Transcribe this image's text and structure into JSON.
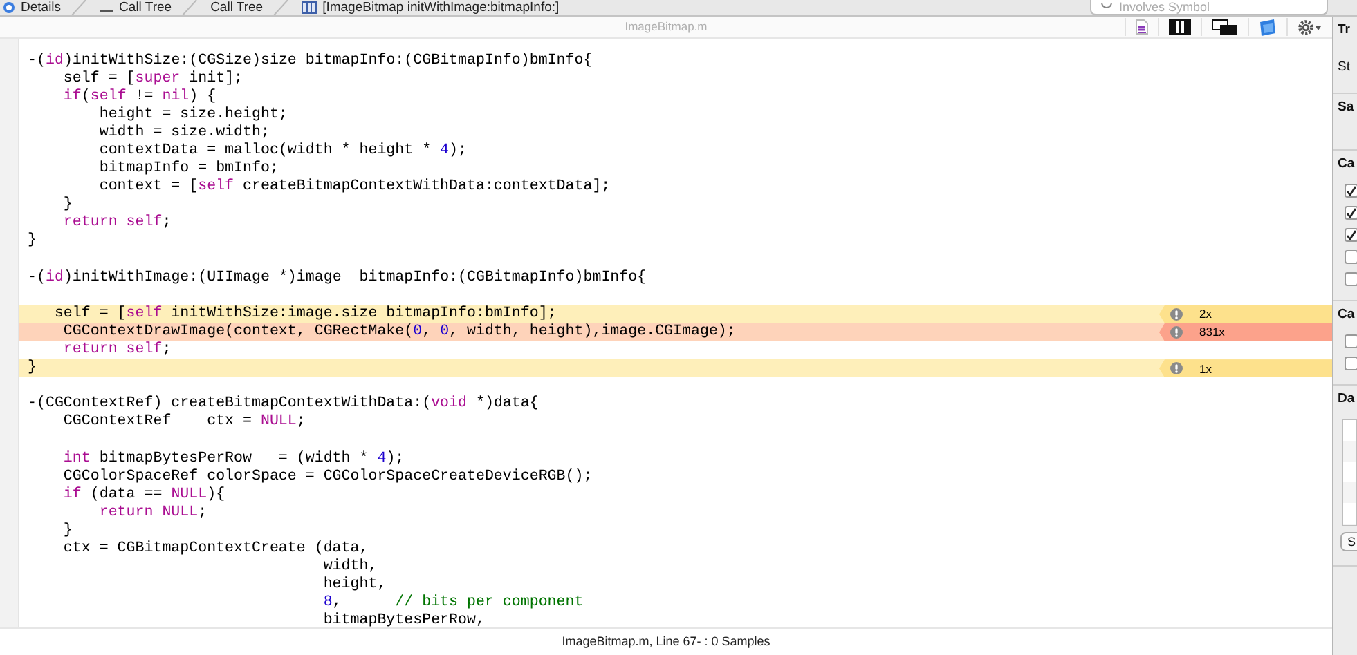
{
  "breadcrumbs": {
    "items": [
      {
        "kind": "circle",
        "label": "Details"
      },
      {
        "kind": "list",
        "label": "Call Tree"
      },
      {
        "kind": "none",
        "label": "Call Tree"
      },
      {
        "kind": "grid",
        "label": "[ImageBitmap initWithImage:bitmapInfo:]"
      }
    ],
    "search": {
      "placeholder": "Involves Symbol"
    }
  },
  "editor": {
    "title": "ImageBitmap.m",
    "lines": [
      {
        "kind": "code",
        "segments": [
          {
            "kind": "plain",
            "text": "-("
          },
          {
            "kind": "keyword",
            "text": "id"
          },
          {
            "kind": "plain",
            "text": ")initWithSize:(CGSize)size bitmapInfo:(CGBitmapInfo)bmInfo{"
          }
        ]
      },
      {
        "kind": "code",
        "segments": [
          {
            "kind": "plain",
            "text": "    self = ["
          },
          {
            "kind": "keyword",
            "text": "super"
          },
          {
            "kind": "plain",
            "text": " init];"
          }
        ]
      },
      {
        "kind": "code",
        "segments": [
          {
            "kind": "keyword",
            "text": "    if"
          },
          {
            "kind": "plain",
            "text": "("
          },
          {
            "kind": "keyword",
            "text": "self"
          },
          {
            "kind": "plain",
            "text": " != "
          },
          {
            "kind": "keyword",
            "text": "nil"
          },
          {
            "kind": "plain",
            "text": ") {"
          }
        ]
      },
      {
        "kind": "code",
        "segments": [
          {
            "kind": "plain",
            "text": "        height = size.height;"
          }
        ]
      },
      {
        "kind": "code",
        "segments": [
          {
            "kind": "plain",
            "text": "        width = size.width;"
          }
        ]
      },
      {
        "kind": "code",
        "segments": [
          {
            "kind": "plain",
            "text": "        contextData = malloc(width * height * "
          },
          {
            "kind": "number",
            "text": "4"
          },
          {
            "kind": "plain",
            "text": ");"
          }
        ]
      },
      {
        "kind": "code",
        "segments": [
          {
            "kind": "plain",
            "text": "        bitmapInfo = bmInfo;"
          }
        ]
      },
      {
        "kind": "code",
        "segments": [
          {
            "kind": "plain",
            "text": "        context = ["
          },
          {
            "kind": "keyword",
            "text": "self"
          },
          {
            "kind": "plain",
            "text": " createBitmapContextWithData:contextData];"
          }
        ]
      },
      {
        "kind": "code",
        "segments": [
          {
            "kind": "plain",
            "text": "    }"
          }
        ]
      },
      {
        "kind": "code",
        "segments": [
          {
            "kind": "keyword",
            "text": "    return self"
          },
          {
            "kind": "plain",
            "text": ";"
          }
        ]
      },
      {
        "kind": "code",
        "segments": [
          {
            "kind": "plain",
            "text": "}"
          }
        ]
      },
      {
        "kind": "blank"
      },
      {
        "kind": "code",
        "segments": [
          {
            "kind": "plain",
            "text": "-("
          },
          {
            "kind": "keyword",
            "text": "id"
          },
          {
            "kind": "plain",
            "text": ")initWithImage:(UIImage *)image  bitmapInfo:(CGBitmapInfo)bmInfo{"
          }
        ]
      },
      {
        "kind": "blank"
      },
      {
        "kind": "code",
        "color": "#fde18c",
        "count": "2x",
        "segments": [
          {
            "kind": "plain",
            "text": "   self = ["
          },
          {
            "kind": "keyword",
            "text": "self"
          },
          {
            "kind": "plain",
            "text": " initWithSize:image.size bitmapInfo:bmInfo];"
          }
        ]
      },
      {
        "kind": "code",
        "color": "#fca28b",
        "count": "831x",
        "segments": [
          {
            "kind": "plain",
            "text": "    CGContextDrawImage(context, CGRectMake("
          },
          {
            "kind": "number",
            "text": "0"
          },
          {
            "kind": "plain",
            "text": ", "
          },
          {
            "kind": "number",
            "text": "0"
          },
          {
            "kind": "plain",
            "text": ", width, height),image.CGImage);"
          }
        ]
      },
      {
        "kind": "code",
        "segments": [
          {
            "kind": "keyword",
            "text": "    return self"
          },
          {
            "kind": "plain",
            "text": ";"
          }
        ]
      },
      {
        "kind": "code",
        "color": "#fde18c",
        "count": "1x",
        "segments": [
          {
            "kind": "plain",
            "text": "}"
          }
        ]
      },
      {
        "kind": "blank"
      },
      {
        "kind": "code",
        "segments": [
          {
            "kind": "plain",
            "text": "-(CGContextRef) createBitmapContextWithData:("
          },
          {
            "kind": "keyword",
            "text": "void"
          },
          {
            "kind": "plain",
            "text": " *)data{"
          }
        ]
      },
      {
        "kind": "code",
        "segments": [
          {
            "kind": "plain",
            "text": "    CGContextRef    ctx = "
          },
          {
            "kind": "keyword",
            "text": "NULL"
          },
          {
            "kind": "plain",
            "text": ";"
          }
        ]
      },
      {
        "kind": "blank"
      },
      {
        "kind": "code",
        "segments": [
          {
            "kind": "keyword",
            "text": "    int"
          },
          {
            "kind": "plain",
            "text": " bitmapBytesPerRow   = (width * "
          },
          {
            "kind": "number",
            "text": "4"
          },
          {
            "kind": "plain",
            "text": ");"
          }
        ]
      },
      {
        "kind": "code",
        "segments": [
          {
            "kind": "plain",
            "text": "    CGColorSpaceRef colorSpace = CGColorSpaceCreateDeviceRGB();"
          }
        ]
      },
      {
        "kind": "code",
        "segments": [
          {
            "kind": "keyword",
            "text": "    if"
          },
          {
            "kind": "plain",
            "text": " (data == "
          },
          {
            "kind": "keyword",
            "text": "NULL"
          },
          {
            "kind": "plain",
            "text": "){"
          }
        ]
      },
      {
        "kind": "code",
        "segments": [
          {
            "kind": "keyword",
            "text": "        return NULL"
          },
          {
            "kind": "plain",
            "text": ";"
          }
        ]
      },
      {
        "kind": "code",
        "segments": [
          {
            "kind": "plain",
            "text": "    }"
          }
        ]
      },
      {
        "kind": "code",
        "segments": [
          {
            "kind": "plain",
            "text": "    ctx = CGBitmapContextCreate (data,"
          }
        ]
      },
      {
        "kind": "code",
        "segments": [
          {
            "kind": "plain",
            "text": "                                 width,"
          }
        ]
      },
      {
        "kind": "code",
        "segments": [
          {
            "kind": "plain",
            "text": "                                 height,"
          }
        ]
      },
      {
        "kind": "code",
        "segments": [
          {
            "kind": "number",
            "text": "                                 8"
          },
          {
            "kind": "plain",
            "text": ",      "
          },
          {
            "kind": "comment",
            "text": "// bits per component"
          }
        ]
      },
      {
        "kind": "code",
        "segments": [
          {
            "kind": "plain",
            "text": "                                 bitmapBytesPerRow,"
          }
        ]
      }
    ],
    "status": "ImageBitmap.m, Line 67- : 0 Samples"
  },
  "inspector": {
    "items": [
      {
        "kind": "heading",
        "text": "Tr"
      },
      {
        "kind": "label",
        "text": "St"
      },
      {
        "kind": "divider"
      },
      {
        "kind": "heading",
        "text": "Sa"
      },
      {
        "kind": "spacer"
      },
      {
        "kind": "divider"
      },
      {
        "kind": "heading",
        "text": "Ca"
      },
      {
        "kind": "checkbox",
        "checked": true
      },
      {
        "kind": "checkbox",
        "checked": true
      },
      {
        "kind": "checkbox",
        "checked": true
      },
      {
        "kind": "checkbox",
        "checked": false
      },
      {
        "kind": "checkbox",
        "checked": false
      },
      {
        "kind": "divider"
      },
      {
        "kind": "heading",
        "text": "Ca"
      },
      {
        "kind": "checkbox",
        "checked": false
      },
      {
        "kind": "checkbox",
        "checked": false
      },
      {
        "kind": "divider"
      },
      {
        "kind": "heading",
        "text": "Da"
      },
      {
        "kind": "table"
      },
      {
        "kind": "button",
        "text": "S"
      },
      {
        "kind": "divider"
      }
    ]
  }
}
